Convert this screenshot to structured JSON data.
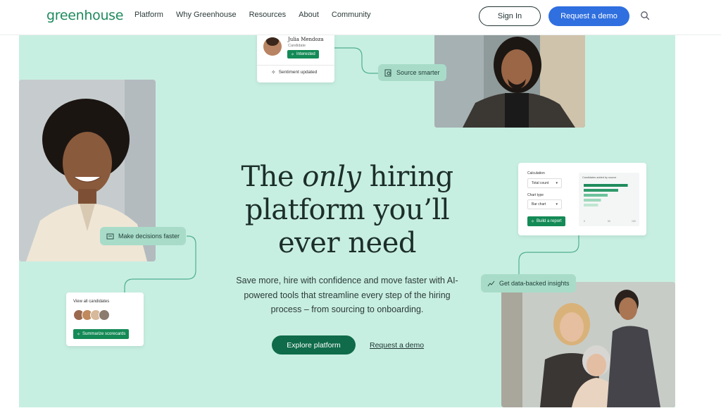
{
  "header": {
    "logo": "greenhouse",
    "nav": [
      "Platform",
      "Why Greenhouse",
      "Resources",
      "About",
      "Community"
    ],
    "sign_in": "Sign In",
    "request_demo": "Request a demo"
  },
  "hero": {
    "headline_pre": "The ",
    "headline_em": "only",
    "headline_post": " hiring platform you’ll ever need",
    "subtext": "Save more, hire with confidence and move faster with AI-powered tools that streamline every step of the hiring process – from sourcing to onboarding.",
    "primary_cta": "Explore platform",
    "secondary_cta": "Request a demo"
  },
  "candidate_card": {
    "name": "Julia Mendoza",
    "role": "Candidate",
    "tag": "Interested",
    "footer": "Sentiment updated"
  },
  "pills": {
    "source": "Source smarter",
    "decisions": "Make decisions faster",
    "insights": "Get data-backed insights"
  },
  "report_card": {
    "calc_label": "Calculation",
    "calc_value": "Total count",
    "type_label": "Chart type",
    "type_value": "Bar chart",
    "button": "Build a report",
    "chart_title": "Candidates added by source",
    "bars": [
      0.92,
      0.72,
      0.5,
      0.36,
      0.3
    ],
    "axis": [
      "0",
      "50",
      "100"
    ]
  },
  "candidates_card": {
    "title": "View all candidates",
    "button": "Summarize scorecards"
  },
  "colors": {
    "brand_green": "#1d8a5d",
    "hero_bg": "#c7efe1",
    "demo_blue": "#2f6fdf",
    "cta_green": "#0f6b4a"
  }
}
